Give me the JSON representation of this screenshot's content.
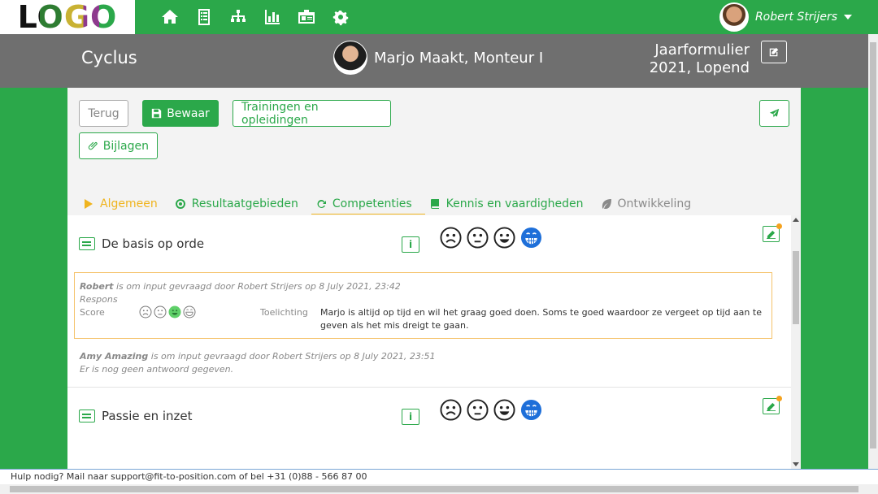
{
  "brand": {
    "logo_text": "LOGO"
  },
  "nav": {
    "icons": [
      "home-icon",
      "checklist-icon",
      "sitemap-icon",
      "bar-chart-icon",
      "id-card-icon",
      "cogs-icon"
    ]
  },
  "user": {
    "name": "Robert Strijers"
  },
  "header": {
    "title": "Cyclus",
    "person": "Marjo Maakt, Monteur I",
    "form_line1": "Jaarformulier",
    "form_line2": "2021, Lopend"
  },
  "toolbar": {
    "back_label": "Terug",
    "save_label": "Bewaar",
    "trainings_label": "Trainingen en opleidingen",
    "attachments_label": "Bijlagen"
  },
  "tabs": [
    {
      "label": "Algemeen",
      "icon": "play-icon",
      "state": "done"
    },
    {
      "label": "Resultaatgebieden",
      "icon": "target-icon",
      "state": "normal"
    },
    {
      "label": "Competenties",
      "icon": "refresh-icon",
      "state": "active"
    },
    {
      "label": "Kennis en vaardigheden",
      "icon": "book-icon",
      "state": "normal"
    },
    {
      "label": "Ontwikkeling",
      "icon": "leaf-icon",
      "state": "muted"
    }
  ],
  "competencies": [
    {
      "title": "De basis op orde",
      "info_label": "i",
      "response": {
        "requester": "Robert",
        "request_text": " is om input gevraagd door Robert Strijers op 8 July 2021, 23:42",
        "respons_label": "Respons",
        "score_label": "Score",
        "toelichting_label": "Toelichting",
        "toelichting_text": "Marjo is altijd op tijd en wil het graag goed doen. Soms te goed waardoor ze vergeet op tijd aan te geven als het mis dreigt te gaan.",
        "selected_score": 3
      },
      "second_requester": "Amy Amazing",
      "second_request_text": " is om input gevraagd door Robert Strijers op 8 July 2021, 23:51",
      "no_answer_text": "Er is nog geen antwoord gegeven."
    },
    {
      "title": "Passie en inzet",
      "info_label": "i"
    }
  ],
  "colors": {
    "brand_green": "#2ba84a",
    "header_gray": "#6f6f6f",
    "accent_yellow": "#f0b41e",
    "selected_blue": "#1e6fd9"
  },
  "footer": {
    "text": "Hulp nodig? Mail naar support@fit-to-position.com of bel +31 (0)88 - 566 87 00"
  }
}
